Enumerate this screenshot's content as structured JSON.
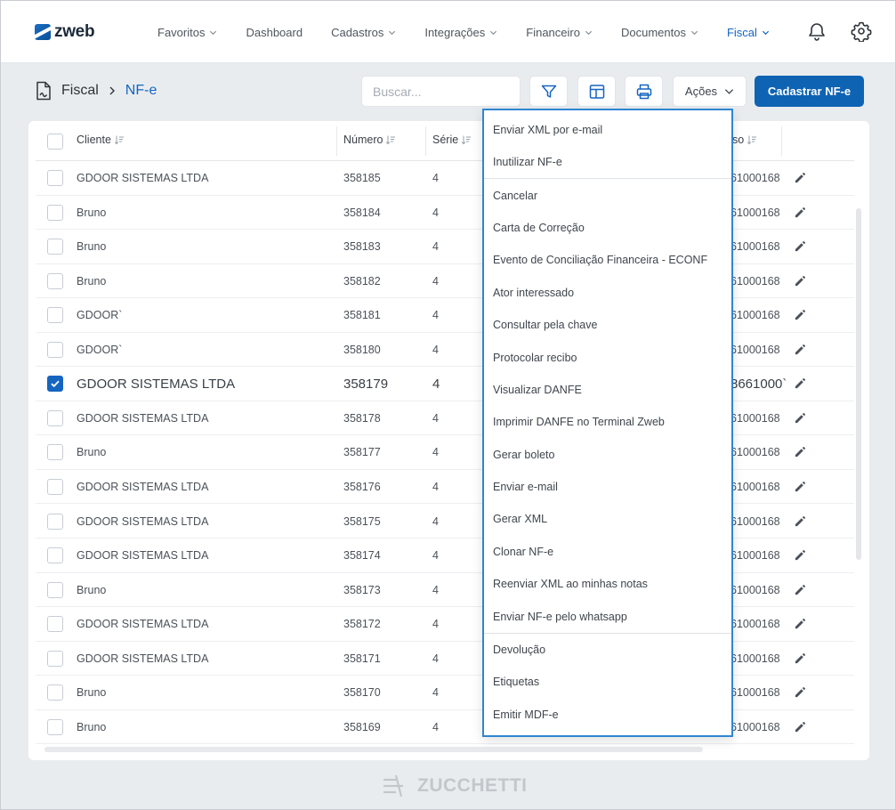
{
  "app": {
    "logo_text": "zweb"
  },
  "nav": {
    "items": [
      {
        "label": "Favoritos",
        "chevron": true,
        "active": false
      },
      {
        "label": "Dashboard",
        "chevron": false,
        "active": false
      },
      {
        "label": "Cadastros",
        "chevron": true,
        "active": false
      },
      {
        "label": "Integrações",
        "chevron": true,
        "active": false
      },
      {
        "label": "Financeiro",
        "chevron": true,
        "active": false
      },
      {
        "label": "Documentos",
        "chevron": true,
        "active": false
      },
      {
        "label": "Fiscal",
        "chevron": true,
        "active": true
      }
    ],
    "icons": [
      "bell-icon",
      "gear-icon"
    ]
  },
  "breadcrumb": {
    "parent": "Fiscal",
    "current": "NF-e"
  },
  "toolbar": {
    "search_placeholder": "Buscar...",
    "actions_label": "Ações",
    "primary_label": "Cadastrar NF-e"
  },
  "table": {
    "columns": {
      "client": "Cliente",
      "number": "Número",
      "series": "Série",
      "key_partial": "so"
    },
    "rows": [
      {
        "client": "GDOOR SISTEMAS LTDA",
        "number": "358185",
        "series": "4",
        "key": "61000168",
        "selected": false
      },
      {
        "client": "Bruno",
        "number": "358184",
        "series": "4",
        "key": "61000168",
        "selected": false
      },
      {
        "client": "Bruno",
        "number": "358183",
        "series": "4",
        "key": "61000168",
        "selected": false
      },
      {
        "client": "Bruno",
        "number": "358182",
        "series": "4",
        "key": "61000168",
        "selected": false
      },
      {
        "client": "GDOOR`",
        "number": "358181",
        "series": "4",
        "key": "61000168",
        "selected": false
      },
      {
        "client": "GDOOR`",
        "number": "358180",
        "series": "4",
        "key": "61000168",
        "selected": false
      },
      {
        "client": "GDOOR SISTEMAS LTDA",
        "number": "358179",
        "series": "4",
        "key": "8661000`",
        "selected": true
      },
      {
        "client": "GDOOR SISTEMAS LTDA",
        "number": "358178",
        "series": "4",
        "key": "61000168",
        "selected": false
      },
      {
        "client": "Bruno",
        "number": "358177",
        "series": "4",
        "key": "61000168",
        "selected": false
      },
      {
        "client": "GDOOR SISTEMAS LTDA",
        "number": "358176",
        "series": "4",
        "key": "61000168",
        "selected": false
      },
      {
        "client": "GDOOR SISTEMAS LTDA",
        "number": "358175",
        "series": "4",
        "key": "61000168",
        "selected": false
      },
      {
        "client": "GDOOR SISTEMAS LTDA",
        "number": "358174",
        "series": "4",
        "key": "61000168",
        "selected": false
      },
      {
        "client": "Bruno",
        "number": "358173",
        "series": "4",
        "key": "61000168",
        "selected": false
      },
      {
        "client": "GDOOR SISTEMAS LTDA",
        "number": "358172",
        "series": "4",
        "key": "61000168",
        "selected": false
      },
      {
        "client": "GDOOR SISTEMAS LTDA",
        "number": "358171",
        "series": "4",
        "key": "61000168",
        "selected": false
      },
      {
        "client": "Bruno",
        "number": "358170",
        "series": "4",
        "key": "61000168",
        "selected": false
      },
      {
        "client": "Bruno",
        "number": "358169",
        "series": "4",
        "key": "61000168",
        "selected": false
      }
    ]
  },
  "actions_menu": {
    "items": [
      "Enviar XML por e-mail",
      "Inutilizar NF-e",
      "Cancelar",
      "Carta de Correção",
      "Evento de Conciliação Financeira - ECONF",
      "Ator interessado",
      "Consultar pela chave",
      "Protocolar recibo",
      "Visualizar DANFE",
      "Imprimir DANFE no Terminal Zweb",
      "Gerar boleto",
      "Enviar e-mail",
      "Gerar XML",
      "Clonar NF-e",
      "Reenviar XML ao minhas notas",
      "Enviar NF-e pelo whatsapp",
      "Devolução",
      "Etiquetas",
      "Emitir MDF-e"
    ]
  },
  "footer": {
    "brand": "ZUCCHETTI"
  },
  "colors": {
    "accent": "#1565c0",
    "primary_button": "#0f63b3",
    "menu_border": "#2f86d1",
    "background": "#e9ecef"
  }
}
